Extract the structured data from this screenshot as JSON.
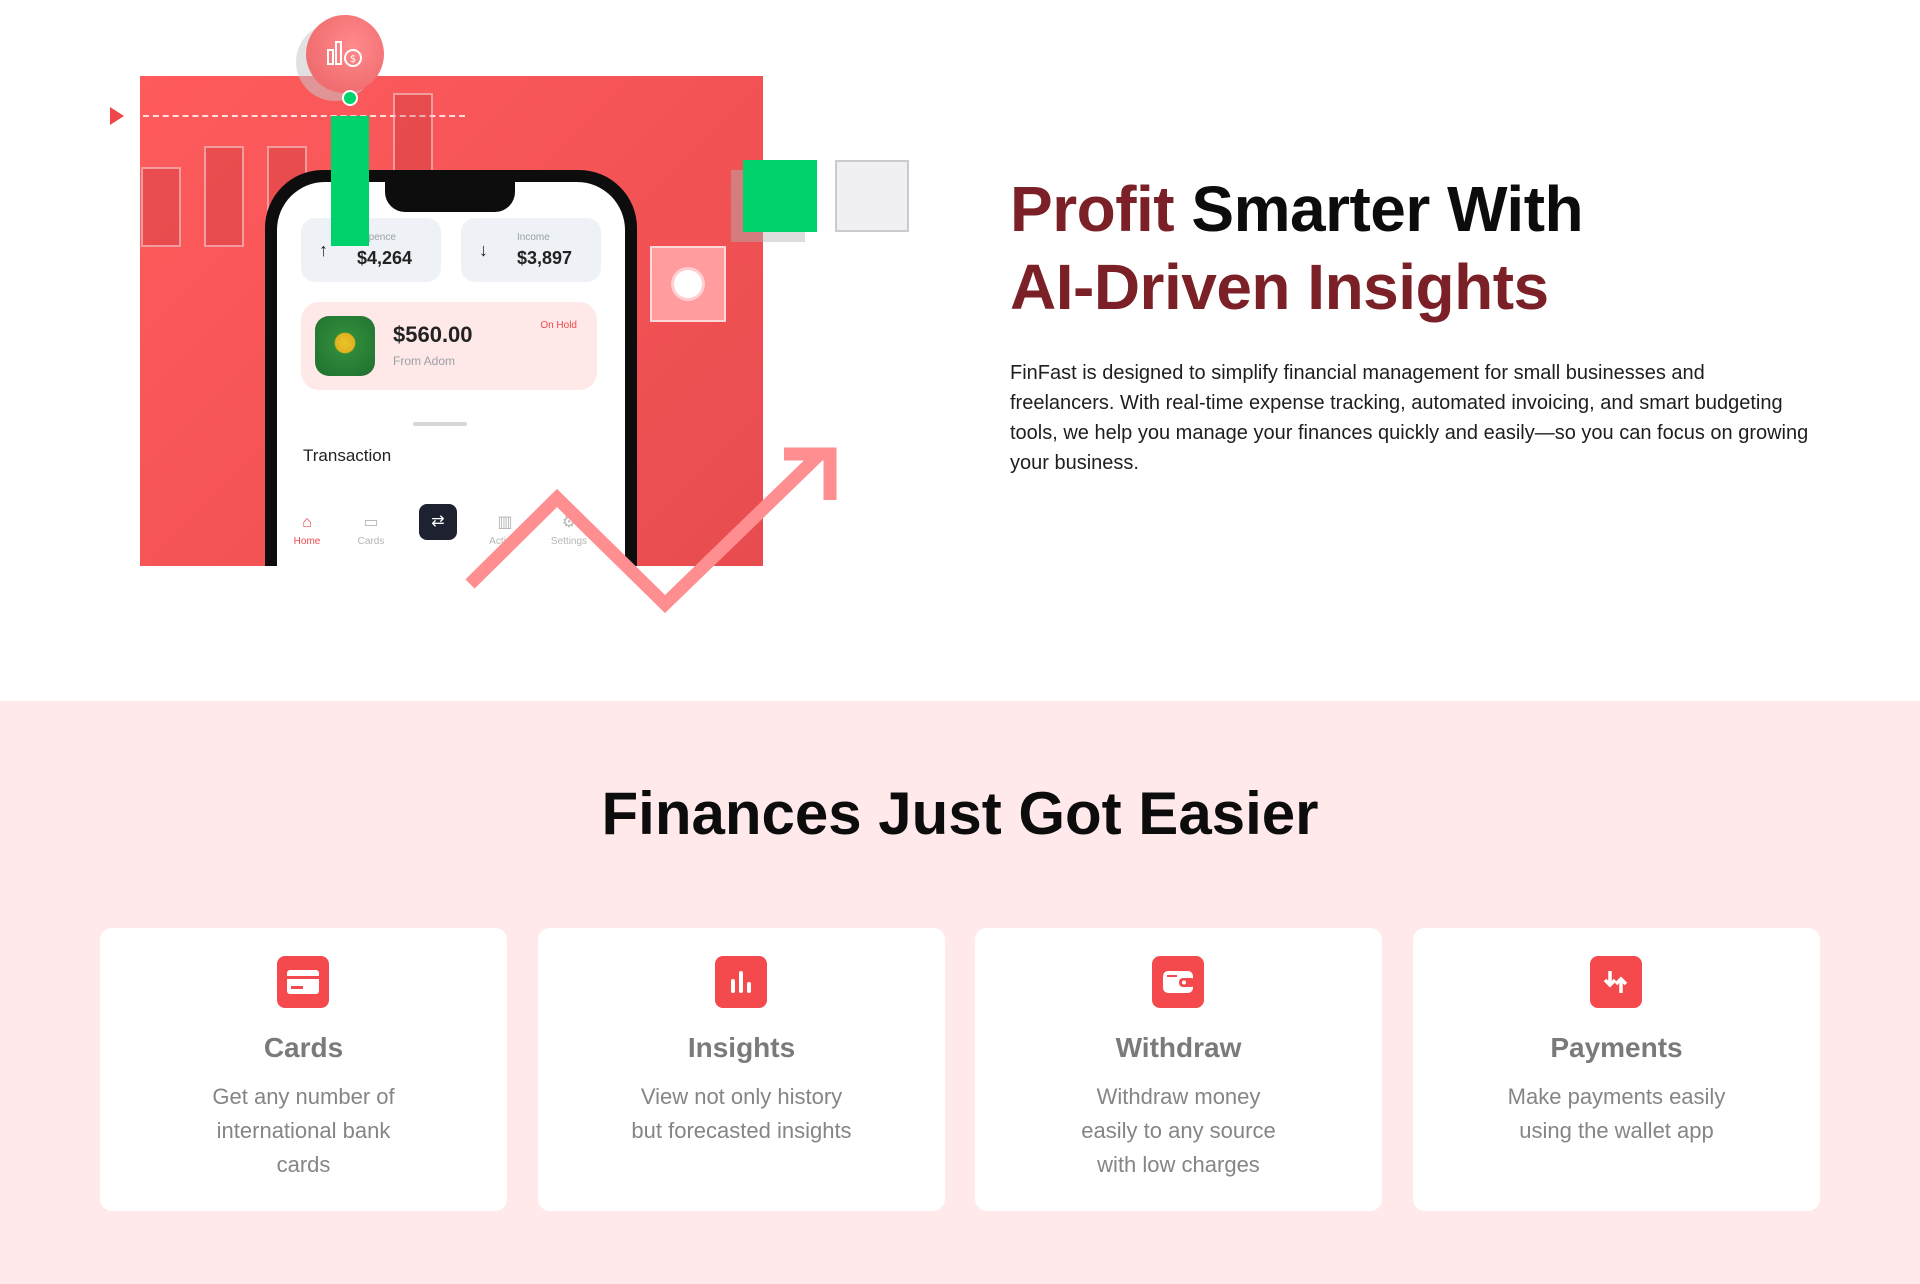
{
  "colors": {
    "brand_red": "#f4494d",
    "accent_dark_red": "#7a2026",
    "green": "#00d36b",
    "features_bg": "#ffe9ea"
  },
  "hero": {
    "headline_accent_1": "Profit",
    "headline_rest_1": " Smarter With",
    "headline_accent_2": "AI-Driven Insights",
    "description": "FinFast is designed to simplify financial management for small businesses and freelancers. With real-time expense tracking, automated invoicing, and smart budgeting tools, we help you manage your finances quickly and easily—so you can focus on growing your business."
  },
  "phone": {
    "expense": {
      "label": "Expence",
      "value": "$4,264",
      "icon": "arrow-up-icon"
    },
    "income": {
      "label": "Income",
      "value": "$3,897",
      "icon": "arrow-down-icon"
    },
    "payment": {
      "amount": "$560.00",
      "from": "From Adom",
      "status": "On Hold"
    },
    "section_label": "Transaction",
    "tabs": [
      {
        "label": "Home",
        "icon": "home-icon"
      },
      {
        "label": "Cards",
        "icon": "card-icon"
      },
      {
        "label": "Activity",
        "icon": "chart-icon"
      },
      {
        "label": "Settings",
        "icon": "gear-icon"
      }
    ],
    "center_action_icon": "swap-icon"
  },
  "features": {
    "title": "Finances Just Got Easier",
    "cards": [
      {
        "title": "Cards",
        "description": "Get any number of international bank cards",
        "icon": "credit-card-icon"
      },
      {
        "title": "Insights",
        "description": "View not only history but forecasted insights",
        "icon": "bar-chart-icon"
      },
      {
        "title": "Withdraw",
        "description": "Withdraw money easily to any source with low charges",
        "icon": "wallet-icon"
      },
      {
        "title": "Payments",
        "description": "Make payments easily using the wallet app",
        "icon": "transfer-arrows-icon"
      }
    ]
  }
}
